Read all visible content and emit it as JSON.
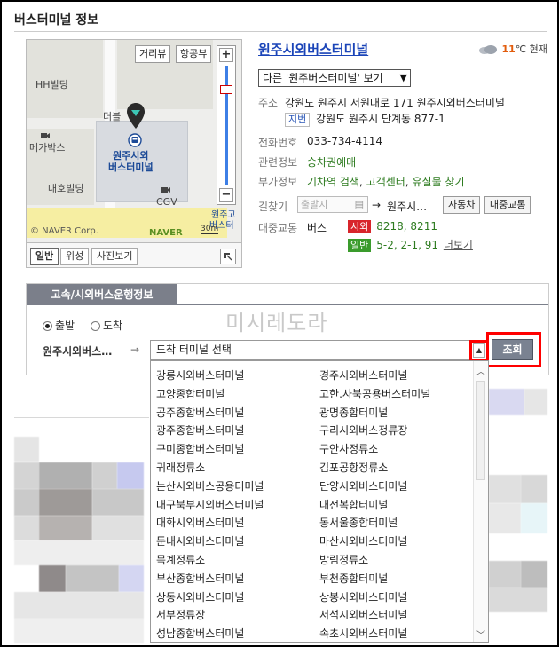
{
  "section": {
    "title": "버스터미널 정보"
  },
  "map": {
    "view_buttons": [
      "거리뷰",
      "항공뷰"
    ],
    "labels": {
      "hh_building": "HH빌딩",
      "deoble": "더블",
      "megabox": "메가박스",
      "daeho": "대호빌딩",
      "cgv": "CGV",
      "terminal": "원주시외\n버스터미널",
      "wonjugo": "원주고",
      "bus_terminal_side": "버스터"
    },
    "copyright": "© NAVER Corp.",
    "brand": "NAVER",
    "scale": "30m",
    "type_buttons": [
      "일반",
      "위성",
      "사진보기"
    ],
    "zoom_plus": "+",
    "zoom_minus": "−",
    "fullscreen_icon": "expand-icon"
  },
  "terminal": {
    "name": "원주시외버스터미널",
    "weather": {
      "icon": "cloud-icon",
      "temp": "11",
      "unit": "℃",
      "label": "현재"
    },
    "other_select": "다른 '원주버스터미널' 보기",
    "address": {
      "label": "주소",
      "road": "강원도 원주시 서원대로 171 원주시외버스터미널",
      "jibun_tag": "지번",
      "jibun": "강원도 원주시 단계동 877-1"
    },
    "phone": {
      "label": "전화번호",
      "value": "033-734-4114"
    },
    "related": {
      "label": "관련정보",
      "value": "승차권예매"
    },
    "extra": {
      "label": "부가정보",
      "values": [
        "기차역 검색",
        "고객센터",
        "유실물 찾기"
      ],
      "separator": ","
    },
    "directions": {
      "label": "길찾기",
      "start_placeholder": "출발지",
      "arrow": "→",
      "end": "원주시…",
      "buttons": [
        "자동차",
        "대중교통"
      ]
    },
    "transit": {
      "label": "대중교통",
      "kind": "버스",
      "rows": [
        {
          "badge": "시외",
          "routes": "8218, 8211"
        },
        {
          "badge": "일반",
          "routes": "5-2, 2-1, 91",
          "more": "더보기"
        }
      ]
    },
    "colors": {
      "link": "#1a44b8",
      "green": "#2d7b1f",
      "red_badge": "#d8252b",
      "green_badge": "#3a9b2c"
    }
  },
  "bus_panel": {
    "tab": "고속/시외버스운행정보",
    "radios": [
      {
        "label": "출발",
        "checked": true
      },
      {
        "label": "도착",
        "checked": false
      }
    ],
    "watermark": "미시레도라",
    "departure": "원주시외버스…",
    "arrow": "→",
    "destination_placeholder": "도착 터미널 선택",
    "search_button": "조회",
    "destinations": [
      [
        "강릉시외버스터미널",
        "경주시외버스터미널"
      ],
      [
        "고양종합터미널",
        "고한.사북공용버스터미널"
      ],
      [
        "공주종합버스터미널",
        "광명종합터미널"
      ],
      [
        "광주종합버스터미널",
        "구리시외버스정류장"
      ],
      [
        "구미종합버스터미널",
        "구안사정류소"
      ],
      [
        "귀래정류소",
        "김포공항정류소"
      ],
      [
        "논산시외버스공용터미널",
        "단양시외버스터미널"
      ],
      [
        "대구북부시외버스터미널",
        "대전복합터미널"
      ],
      [
        "대화시외버스터미널",
        "동서울종합터미널"
      ],
      [
        "둔내시외버스터미널",
        "마산시외버스터미널"
      ],
      [
        "목계정류소",
        "방림정류소"
      ],
      [
        "부산종합버스터미널",
        "부천종합터미널"
      ],
      [
        "상동시외버스터미널",
        "상봉시외버스터미널"
      ],
      [
        "서부정류장",
        "서석시외버스터미널"
      ],
      [
        "성남종합버스터미널",
        "속초시외버스터미널"
      ]
    ]
  }
}
